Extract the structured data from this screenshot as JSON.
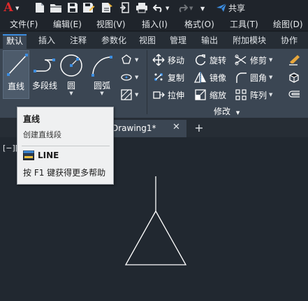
{
  "app": {
    "logo_letter": "A"
  },
  "quick_access": {
    "share_label": "共享",
    "icons": [
      "new-file-icon",
      "open-folder-icon",
      "save-icon",
      "save-as-icon",
      "save-to-cloud-icon",
      "import-icon",
      "export-icon",
      "print-icon",
      "undo-icon",
      "redo-icon",
      "customize-icon",
      "share-icon"
    ]
  },
  "menubar": {
    "items": [
      "文件(F)",
      "编辑(E)",
      "视图(V)",
      "插入(I)",
      "格式(O)",
      "工具(T)",
      "绘图(D)"
    ]
  },
  "ribbon_tabs": [
    "默认",
    "插入",
    "注释",
    "参数化",
    "视图",
    "管理",
    "输出",
    "附加模块",
    "协作"
  ],
  "ribbon": {
    "draw": {
      "line": "直线",
      "polyline": "多段线",
      "circle": "圆",
      "arc": "圆弧"
    },
    "modify": {
      "move": "移动",
      "rotate": "旋转",
      "trim": "修剪",
      "copy": "复制",
      "mirror": "镜像",
      "fillet": "圆角",
      "stretch": "拉伸",
      "scale": "缩放",
      "array": "阵列",
      "panel_title": "修改"
    }
  },
  "document_tabs": {
    "active_name": "Drawing1*"
  },
  "viewport": {
    "label": "[−]["
  },
  "tooltip": {
    "title": "直线",
    "description": "创建直线段",
    "command": "LINE",
    "help": "按 F1 键获得更多帮助"
  },
  "colors": {
    "accent": "#3c8de0",
    "logo": "#e0292b",
    "ribbon_bg": "#3b4653",
    "canvas_bg": "#212830",
    "menubar_bg": "#1f242b",
    "tooltip_bg": "#eff0f1"
  }
}
